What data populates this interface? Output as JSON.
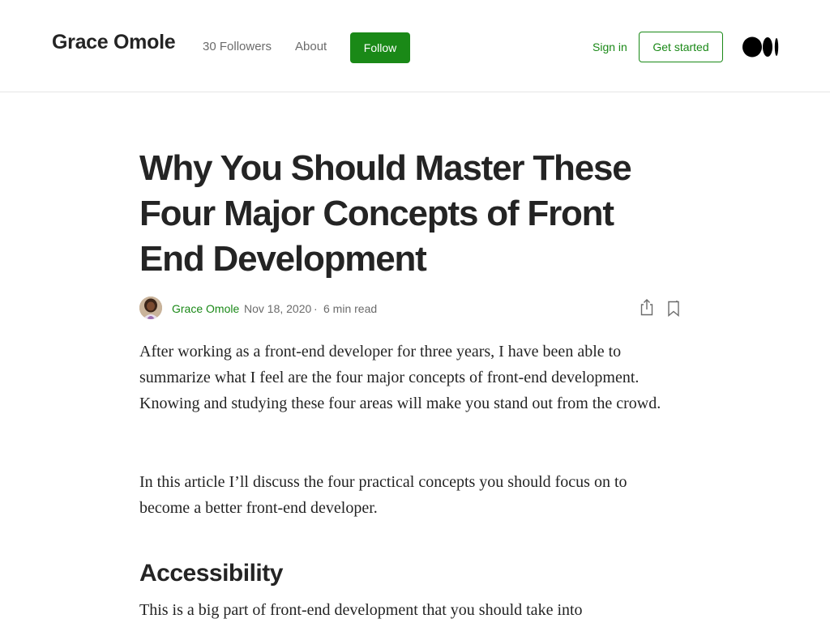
{
  "header": {
    "publication": "Grace Omole",
    "followers": "30 Followers",
    "about": "About",
    "follow": "Follow",
    "sign_in": "Sign in",
    "get_started": "Get started",
    "logo_icon": "medium-logo-icon"
  },
  "article": {
    "title": "Why You Should Master These Four Major Concepts of Front End Development",
    "author": "Grace Omole",
    "date": "Nov 18, 2020",
    "separator": "·",
    "read_time": "6 min read",
    "icons": {
      "share": "share-icon",
      "bookmark": "bookmark-icon"
    },
    "paragraphs": [
      "After working as a front-end developer for three years, I have been able to summarize what I feel are the four major concepts of front-end development. Knowing and studying these four areas will make you stand out from the crowd.",
      "In this article I’ll discuss the four practical concepts you should focus on to become a better front-end developer.",
      "This is a big part of front-end development that you should take into"
    ],
    "section_heading": "Accessibility"
  },
  "colors": {
    "accent": "#1a8917",
    "text": "#242424",
    "muted": "#6b6b6b",
    "divider": "#e6e6e6"
  }
}
